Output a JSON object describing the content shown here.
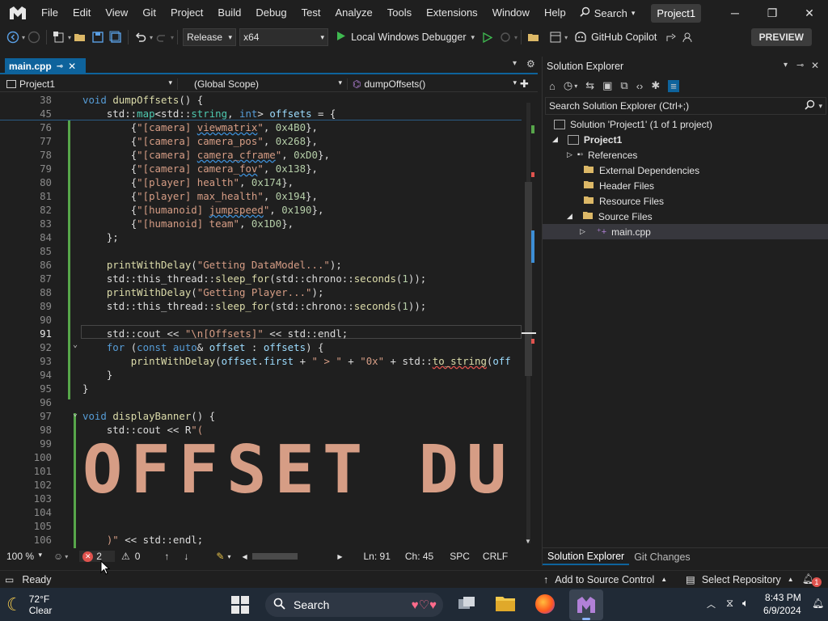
{
  "menubar": {
    "items": [
      "File",
      "Edit",
      "View",
      "Git",
      "Project",
      "Build",
      "Debug",
      "Test",
      "Analyze",
      "Tools",
      "Extensions",
      "Window",
      "Help"
    ],
    "search_label": "Search",
    "project_name": "Project1"
  },
  "toolbar": {
    "configuration": "Release",
    "platform": "x64",
    "debugger_label": "Local Windows Debugger",
    "copilot_label": "GitHub Copilot",
    "preview_label": "PREVIEW"
  },
  "editor": {
    "tab_label": "main.cpp",
    "nav_project": "Project1",
    "nav_scope": "(Global Scope)",
    "nav_function": "dumpOffsets()",
    "zoom": "100 %",
    "errors": "2",
    "warnings": "0",
    "line": "Ln: 91",
    "col": "Ch: 45",
    "whitespace": "SPC",
    "line_ending": "CRLF",
    "line_numbers": [
      "38",
      "45",
      "76",
      "77",
      "78",
      "79",
      "80",
      "81",
      "82",
      "83",
      "84",
      "85",
      "86",
      "87",
      "88",
      "89",
      "90",
      "91",
      "92",
      "93",
      "94",
      "95",
      "96",
      "97",
      "98",
      "99",
      "100",
      "101",
      "102",
      "103",
      "104",
      "105",
      "106"
    ],
    "code_lines": [
      "void dumpOffsets() {",
      "    std::map<std::string, int> offsets = {",
      "        {\"[camera] viewmatrix\", 0x4B0},",
      "        {\"[camera] camera_pos\", 0x268},",
      "        {\"[camera] camera_cframe\", 0xD0},",
      "        {\"[camera] camera_fov\", 0x138},",
      "        {\"[player] health\", 0x174},",
      "        {\"[player] max_health\", 0x194},",
      "        {\"[humanoid] jumpspeed\", 0x190},",
      "        {\"[humanoid] team\", 0x1D0},",
      "    };",
      "",
      "    printWithDelay(\"Getting DataModel...\");",
      "    std::this_thread::sleep_for(std::chrono::seconds(1));",
      "    printWithDelay(\"Getting Player...\");",
      "    std::this_thread::sleep_for(std::chrono::seconds(1));",
      "",
      "    std::cout << \"\\n[Offsets]\" << std::endl;",
      "    for (const auto& offset : offsets) {",
      "        printWithDelay(offset.first + \" > \" + \"0x\" + std::to_string(off",
      "    }",
      "}",
      "",
      "void displayBanner() {",
      "    std::cout << R\"(",
      "",
      "",
      "",
      "",
      "",
      "",
      "",
      "    )\" << std::endl;"
    ],
    "banner_text": "OFFSET DU"
  },
  "solution_explorer": {
    "title": "Solution Explorer",
    "search_placeholder": "Search Solution Explorer (Ctrl+;)",
    "solution_label": "Solution 'Project1' (1 of 1 project)",
    "project_label": "Project1",
    "nodes": [
      "References",
      "External Dependencies",
      "Header Files",
      "Resource Files",
      "Source Files",
      "main.cpp"
    ],
    "bottom_tabs": [
      "Solution Explorer",
      "Git Changes"
    ]
  },
  "statusbar": {
    "ready": "Ready",
    "add_source": "Add to Source Control",
    "select_repo": "Select Repository",
    "notification_count": "1"
  },
  "taskbar": {
    "weather_temp": "72°F",
    "weather_desc": "Clear",
    "search_label": "Search",
    "time": "8:43 PM",
    "date": "6/9/2024"
  },
  "colors": {
    "accent": "#0e639c",
    "change_bar": "#57a64a",
    "error": "#e0534e"
  }
}
